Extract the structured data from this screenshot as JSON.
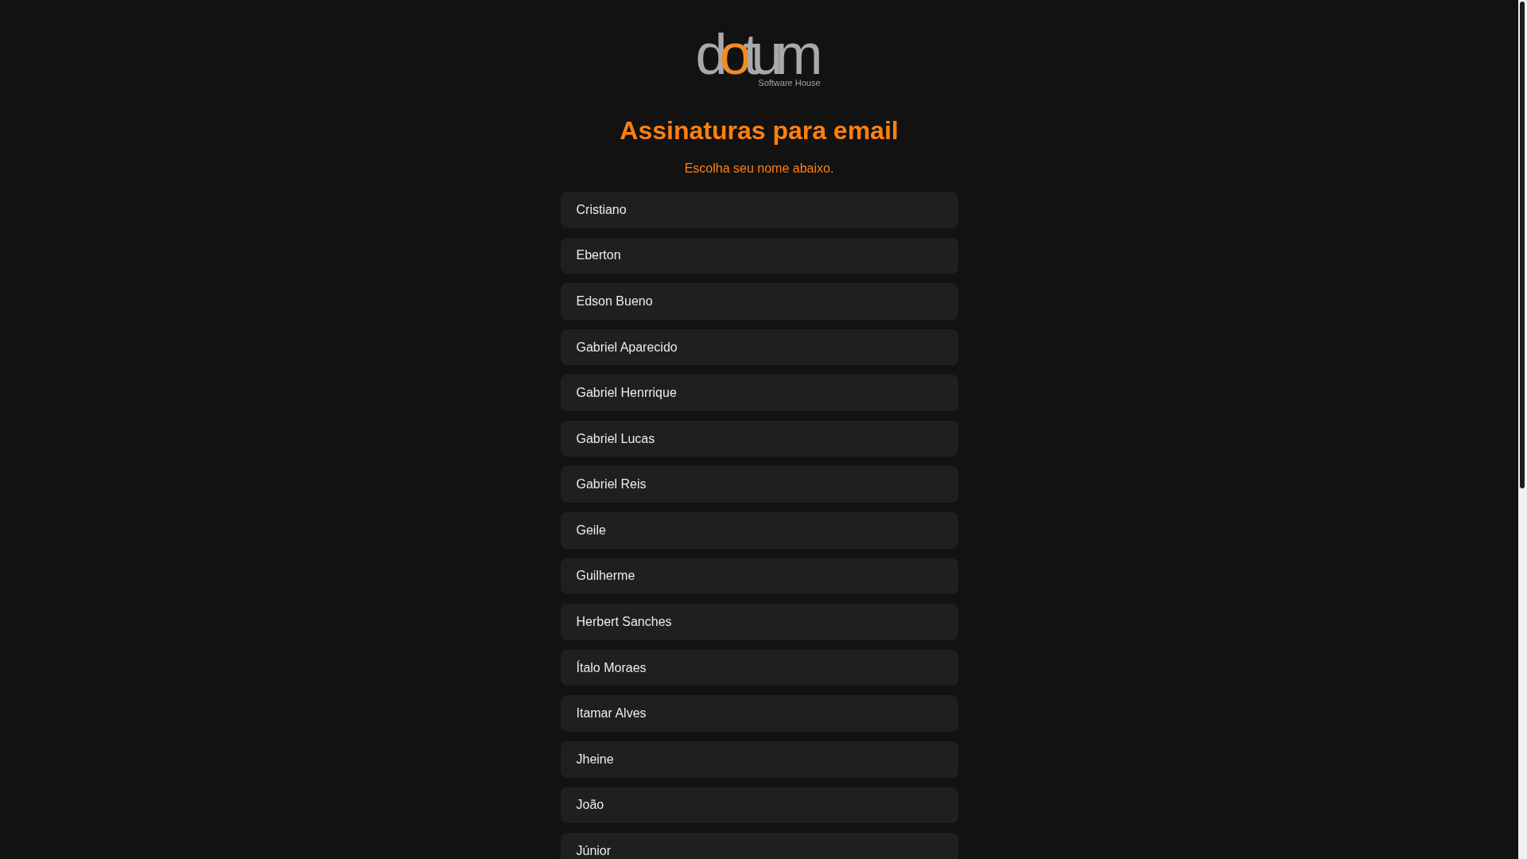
{
  "logo": {
    "wordmark": [
      {
        "text": "d",
        "accent": false
      },
      {
        "text": "o",
        "accent": true
      },
      {
        "text": "tum",
        "accent": false
      }
    ],
    "tagline": "Software House"
  },
  "title": "Assinaturas para email",
  "subtitle": "Escolha seu nome abaixo.",
  "names": [
    "Cristiano",
    "Eberton",
    "Edson Bueno",
    "Gabriel Aparecido",
    "Gabriel Henrrique",
    "Gabriel Lucas",
    "Gabriel Reis",
    "Geile",
    "Guilherme",
    "Herbert Sanches",
    "Ítalo Moraes",
    "Itamar Alves",
    "Jheine",
    "João",
    "Júnior"
  ]
}
